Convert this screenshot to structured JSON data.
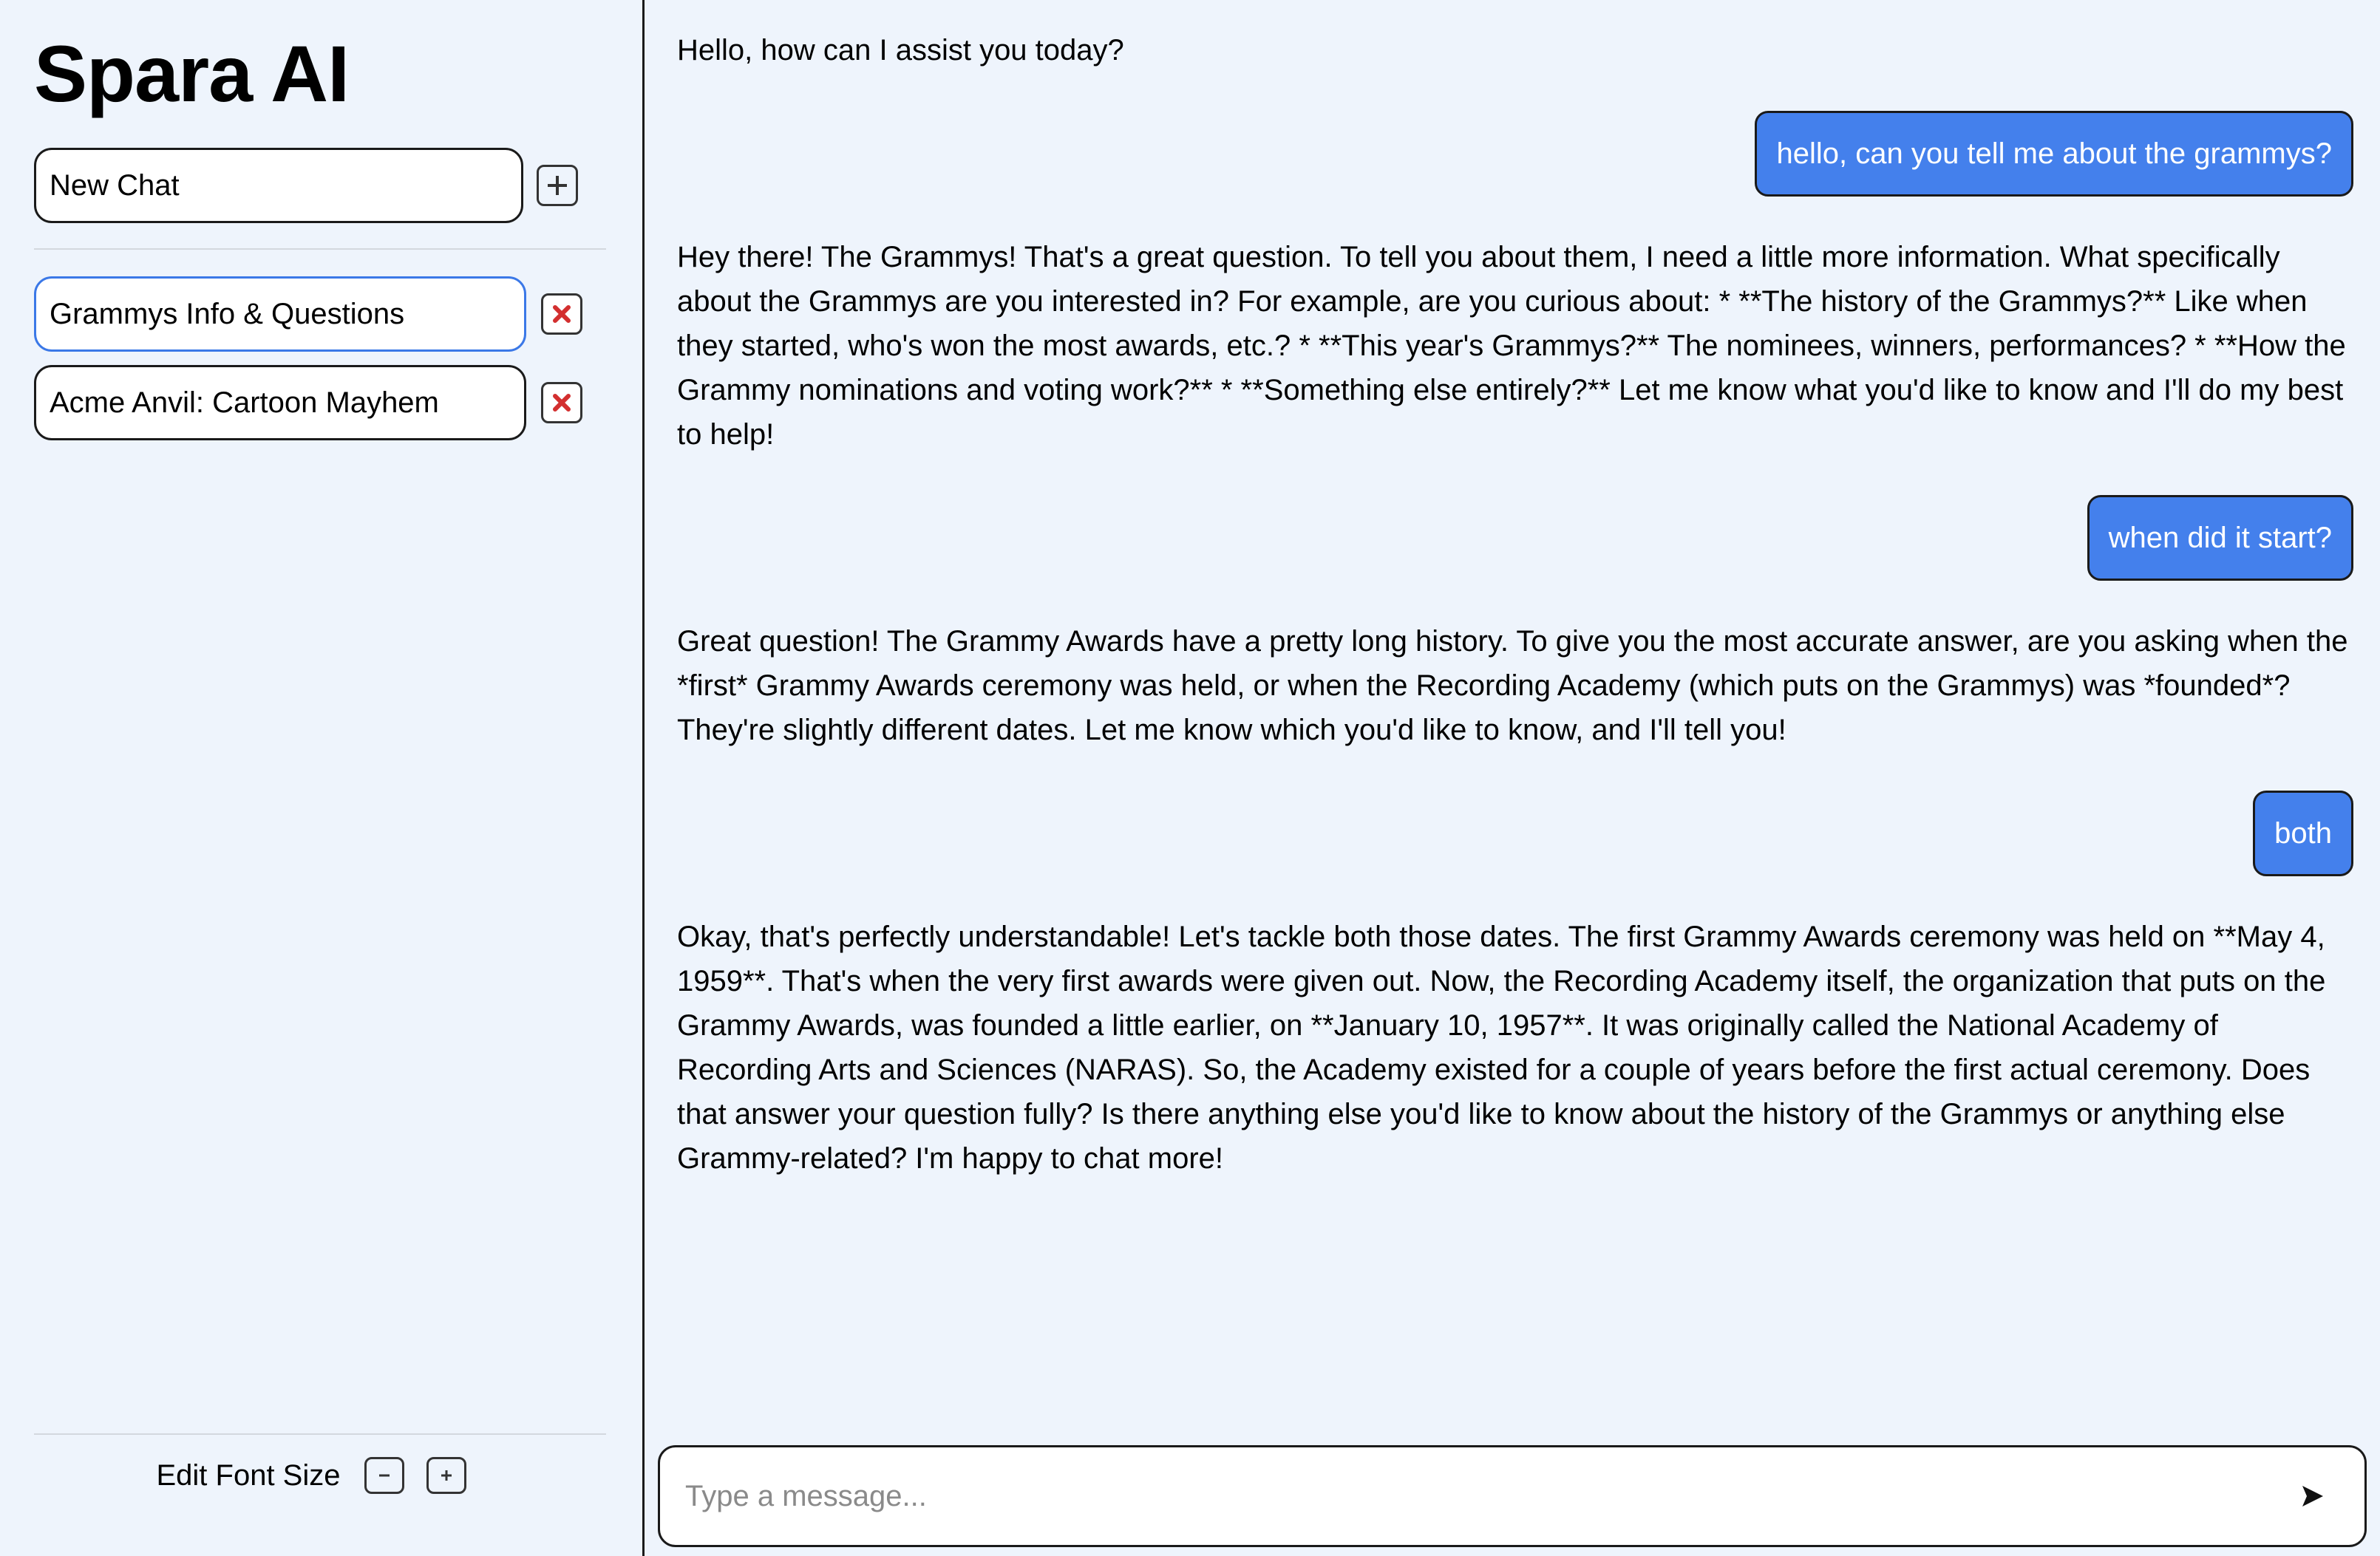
{
  "app": {
    "title": "Spara AI"
  },
  "sidebar": {
    "new_chat_value": "New Chat",
    "chats": [
      {
        "label": "Grammys Info & Questions",
        "active": true
      },
      {
        "label": "Acme Anvil: Cartoon Mayhem",
        "active": false
      }
    ],
    "font_size_label": "Edit Font Size",
    "font_decrease": "−",
    "font_increase": "+"
  },
  "messages": [
    {
      "role": "bot",
      "text": "Hello, how can I assist you today?"
    },
    {
      "role": "user",
      "text": "hello, can you tell me about the grammys?"
    },
    {
      "role": "bot",
      "text": "Hey there! The Grammys! That's a great question. To tell you about them, I need a little more information. What specifically about the Grammys are you interested in? For example, are you curious about: * **The history of the Grammys?** Like when they started, who's won the most awards, etc.? * **This year's Grammys?** The nominees, winners, performances? * **How the Grammy nominations and voting work?** * **Something else entirely?** Let me know what you'd like to know and I'll do my best to help!"
    },
    {
      "role": "user",
      "text": "when did it start?"
    },
    {
      "role": "bot",
      "text": "Great question! The Grammy Awards have a pretty long history. To give you the most accurate answer, are you asking when the *first* Grammy Awards ceremony was held, or when the Recording Academy (which puts on the Grammys) was *founded*? They're slightly different dates. Let me know which you'd like to know, and I'll tell you!"
    },
    {
      "role": "user",
      "text": "both"
    },
    {
      "role": "bot",
      "text": "Okay, that's perfectly understandable! Let's tackle both those dates. The first Grammy Awards ceremony was held on **May 4, 1959**. That's when the very first awards were given out. Now, the Recording Academy itself, the organization that puts on the Grammy Awards, was founded a little earlier, on **January 10, 1957**. It was originally called the National Academy of Recording Arts and Sciences (NARAS). So, the Academy existed for a couple of years before the first actual ceremony. Does that answer your question fully? Is there anything else you'd like to know about the history of the Grammys or anything else Grammy-related? I'm happy to chat more!"
    }
  ],
  "composer": {
    "placeholder": "Type a message..."
  },
  "colors": {
    "background": "#eef4fc",
    "user_bubble": "#4480ec",
    "active_border": "#3b78e7",
    "delete_red": "#d32f2f"
  },
  "icons": {
    "add": "plus-icon",
    "delete": "x-icon",
    "send": "send-arrow-icon"
  }
}
